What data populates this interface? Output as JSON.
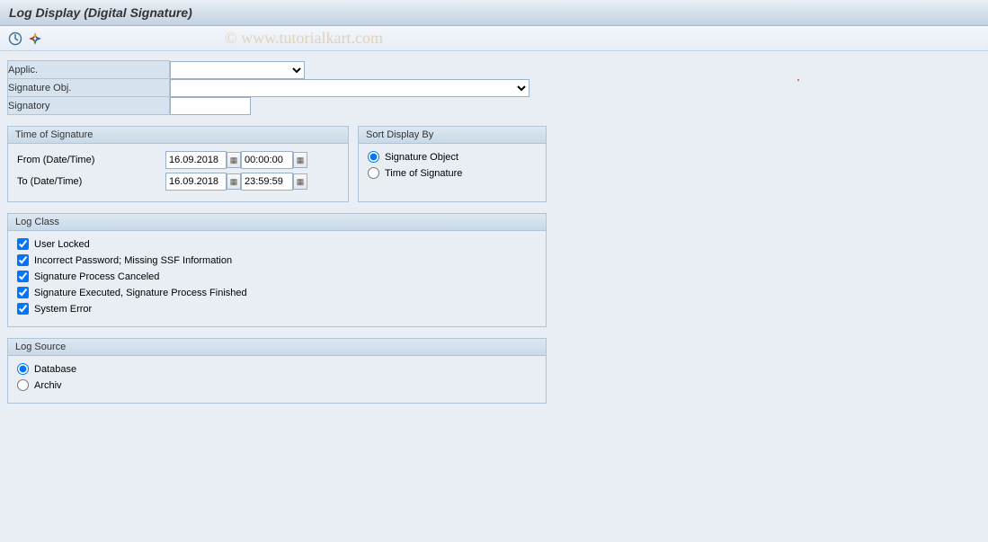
{
  "title": "Log Display (Digital Signature)",
  "watermark": "© www.tutorialkart.com",
  "fields": {
    "applic_label": "Applic.",
    "sigobj_label": "Signature Obj.",
    "signatory_label": "Signatory",
    "applic_value": "",
    "sigobj_value": "",
    "signatory_value": ""
  },
  "time_group": {
    "title": "Time of Signature",
    "from_label": "From (Date/Time)",
    "to_label": "To (Date/Time)",
    "from_date": "16.09.2018",
    "from_time": "00:00:00",
    "to_date": "16.09.2018",
    "to_time": "23:59:59"
  },
  "sort_group": {
    "title": "Sort Display By",
    "opt1": "Signature Object",
    "opt2": "Time of Signature",
    "selected": "opt1"
  },
  "logclass_group": {
    "title": "Log Class",
    "items": [
      {
        "label": "User Locked",
        "checked": true
      },
      {
        "label": "Incorrect Password; Missing SSF Information",
        "checked": true
      },
      {
        "label": "Signature Process Canceled",
        "checked": true
      },
      {
        "label": "Signature Executed, Signature Process Finished",
        "checked": true
      },
      {
        "label": "System Error",
        "checked": true
      }
    ]
  },
  "logsrc_group": {
    "title": "Log Source",
    "opt1": "Database",
    "opt2": "Archiv",
    "selected": "opt1"
  }
}
